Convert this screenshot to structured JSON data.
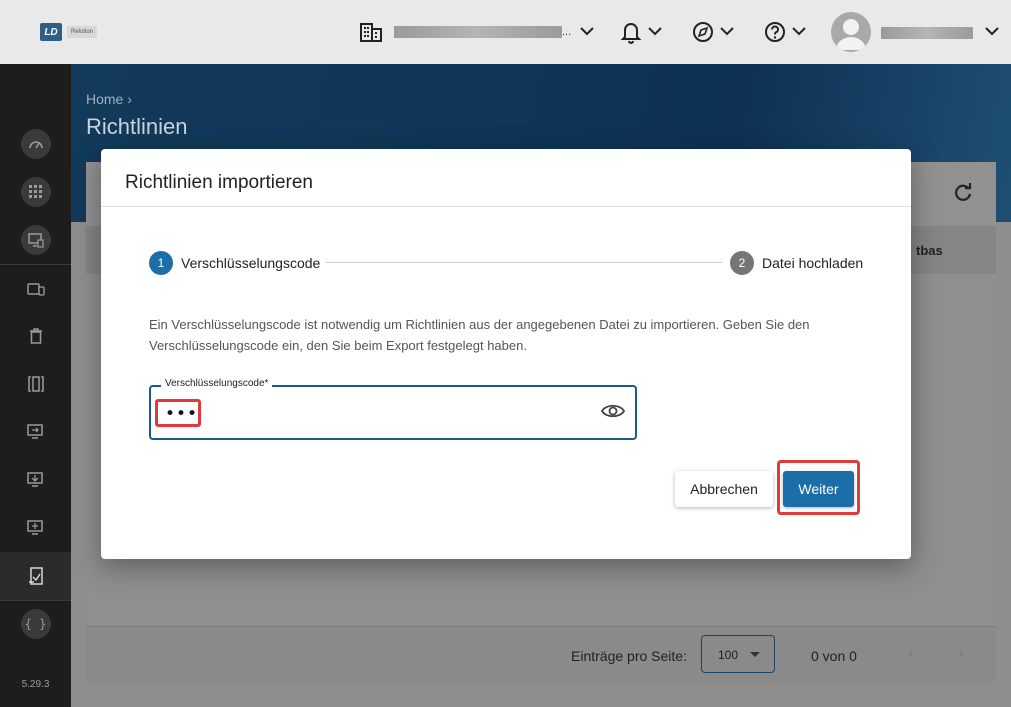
{
  "app": {
    "logo_mark": "LD",
    "logo_text": "Relution"
  },
  "topbar": {
    "organization_name": "",
    "organization_ellipsis": "...",
    "icons": [
      "building-icon",
      "bell-icon",
      "compass-icon",
      "help-icon",
      "avatar"
    ]
  },
  "sidebar": {
    "items": [
      {
        "icon": "dashboard-icon"
      },
      {
        "icon": "apps-grid-icon"
      },
      {
        "icon": "device-screen-icon"
      },
      {
        "icon": "devices-icon"
      },
      {
        "icon": "trash-icon"
      },
      {
        "icon": "phone-frame-icon"
      },
      {
        "icon": "screen-share-icon"
      },
      {
        "icon": "download-icon"
      },
      {
        "icon": "monitor-add-icon"
      },
      {
        "icon": "policy-import-icon",
        "active": true
      },
      {
        "icon": "code-braces-icon"
      }
    ],
    "version": "5.29.3"
  },
  "main": {
    "breadcrumb": "Home ›",
    "title": "Richtlinien",
    "column_header_partial": "tbas",
    "footer": {
      "rows_per_page_label": "Einträge pro Seite:",
      "rows_per_page_value": "100",
      "page_info": "0 von 0"
    }
  },
  "dialog": {
    "title": "Richtlinien importieren",
    "steps": [
      {
        "number": "1",
        "label": "Verschlüsselungscode",
        "active": true
      },
      {
        "number": "2",
        "label": "Datei hochladen",
        "active": false
      }
    ],
    "description": "Ein Verschlüsselungscode ist notwendig um Richtlinien aus der angegebenen Datei zu importieren. Geben Sie den Verschlüsselungscode ein, den Sie beim Export festgelegt haben.",
    "field": {
      "label": "Verschlüsselungscode*",
      "value": "•••"
    },
    "buttons": {
      "cancel": "Abbrechen",
      "next": "Weiter"
    }
  },
  "colors": {
    "primary": "#1b6ea8",
    "step_active": "#1b6ea8",
    "step_inactive": "#757575",
    "highlight": "#e03a3f",
    "sidebar_bg": "#1d1d1d"
  }
}
